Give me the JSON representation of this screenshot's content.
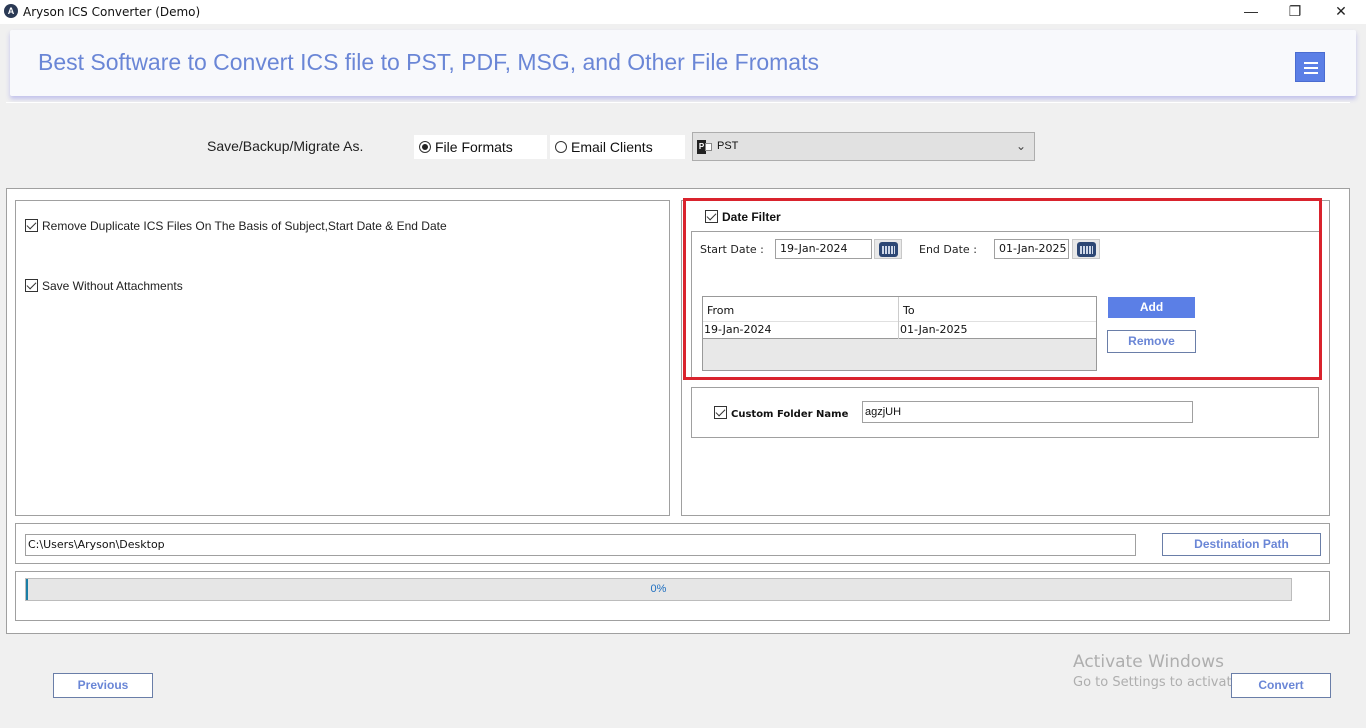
{
  "window": {
    "title": "Aryson ICS Converter (Demo)",
    "app_icon": "aryson-logo-icon",
    "controls": {
      "minimize": "—",
      "maximize": "❐",
      "close": "✕"
    }
  },
  "header": {
    "title": "Best Software to Convert ICS file to PST, PDF, MSG, and Other File Fromats",
    "menu_icon": "hamburger-menu-icon"
  },
  "save_as": {
    "label": "Save/Backup/Migrate As.",
    "options": [
      {
        "label": "File Formats",
        "selected": true
      },
      {
        "label": "Email Clients",
        "selected": false
      }
    ],
    "format_select": {
      "value": "PST",
      "icon": "outlook-pst-icon"
    }
  },
  "options": {
    "remove_duplicates": {
      "label": "Remove Duplicate ICS Files On The Basis of Subject,Start Date & End Date",
      "checked": true
    },
    "save_without_attachments": {
      "label": "Save Without Attachments",
      "checked": true
    }
  },
  "date_filter": {
    "label": "Date Filter",
    "checked": true,
    "start_label": "Start Date :",
    "start_value": "19-Jan-2024",
    "end_label": "End Date :",
    "end_value": "01-Jan-2025",
    "table": {
      "columns": [
        "From",
        "To"
      ],
      "rows": [
        [
          "19-Jan-2024",
          "01-Jan-2025"
        ]
      ]
    },
    "add_label": "Add",
    "remove_label": "Remove"
  },
  "custom_folder": {
    "label": "Custom Folder Name",
    "checked": true,
    "value": "agzjUH"
  },
  "destination": {
    "path": "C:\\Users\\Aryson\\Desktop",
    "button_label": "Destination Path"
  },
  "progress": {
    "percent": 0,
    "text": "0%"
  },
  "footer": {
    "previous_label": "Previous",
    "convert_label": "Convert"
  },
  "watermark": {
    "line1": "Activate Windows",
    "line2": "Go to Settings to activate Windows."
  },
  "colors": {
    "accent": "#5b7fe6",
    "header_text": "#6a86d6",
    "highlight": "#d9232d",
    "progress": "#1a7ea6"
  }
}
